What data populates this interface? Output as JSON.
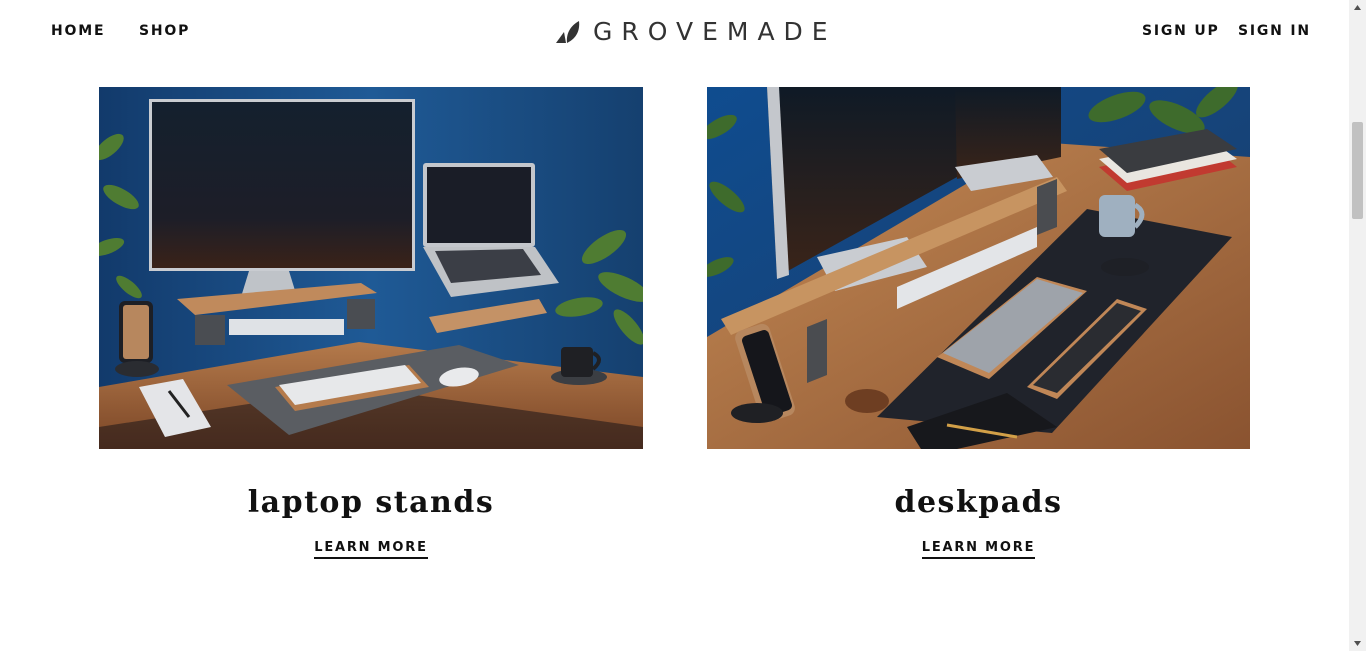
{
  "nav": {
    "home": "HOME",
    "shop": "SHOP",
    "sign_up": "SIGN UP",
    "sign_in": "SIGN IN"
  },
  "brand": {
    "name": "GROVEMADE",
    "logo_icon": "leaf-logo-icon"
  },
  "cards": [
    {
      "title": "laptop stands",
      "cta": "LEARN MORE",
      "image": "photo of desk with monitor riser, laptop stand, keyboard, felt mat, plants"
    },
    {
      "title": "deskpads",
      "cta": "LEARN MORE",
      "image": "photo of desk with monitor shelf, leather deskpad, keyboard, wrist rest, books"
    }
  ],
  "colors": {
    "text": "#111111",
    "logo": "#333333",
    "photo_blue": "#1f4f86",
    "wood": "#a96b3f"
  }
}
